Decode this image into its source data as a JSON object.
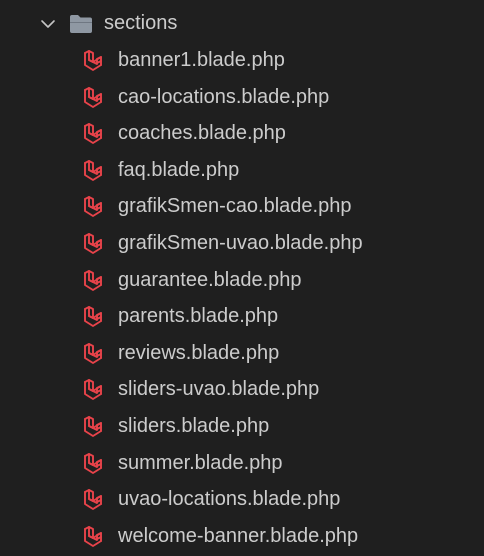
{
  "folder": {
    "name": "sections",
    "expanded": true,
    "icon": "folder-open-icon",
    "icon_color": "#8f98a3"
  },
  "file_icon": "laravel-icon",
  "file_icon_color": "#e8434a",
  "files": [
    {
      "name": "banner1.blade.php"
    },
    {
      "name": "cao-locations.blade.php"
    },
    {
      "name": "coaches.blade.php"
    },
    {
      "name": "faq.blade.php"
    },
    {
      "name": "grafikSmen-cao.blade.php"
    },
    {
      "name": "grafikSmen-uvao.blade.php"
    },
    {
      "name": "guarantee.blade.php"
    },
    {
      "name": "parents.blade.php"
    },
    {
      "name": "reviews.blade.php"
    },
    {
      "name": "sliders-uvao.blade.php"
    },
    {
      "name": "sliders.blade.php"
    },
    {
      "name": "summer.blade.php"
    },
    {
      "name": "uvao-locations.blade.php"
    },
    {
      "name": "welcome-banner.blade.php"
    }
  ]
}
